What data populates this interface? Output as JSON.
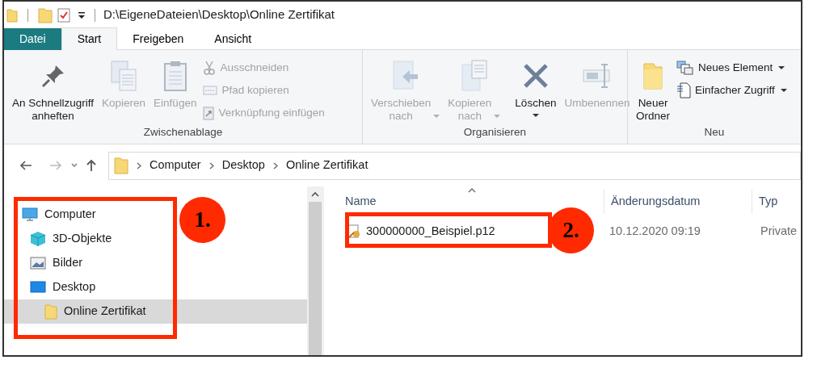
{
  "title_bar": {
    "path": "D:\\EigeneDateien\\Desktop\\Online Zertifikat"
  },
  "tabs": [
    {
      "label": "Datei",
      "kind": "file",
      "selected": false
    },
    {
      "label": "Start",
      "kind": "tab",
      "selected": true
    },
    {
      "label": "Freigeben",
      "kind": "tab",
      "selected": false
    },
    {
      "label": "Ansicht",
      "kind": "tab",
      "selected": false
    }
  ],
  "ribbon": {
    "groups": [
      {
        "label": "Zwischenablage",
        "items": [
          {
            "label": "An Schnellzugriff\nanheften",
            "kind": "large",
            "disabled": false,
            "dropdown": false
          },
          {
            "label": "Kopieren",
            "kind": "large",
            "disabled": true,
            "dropdown": false
          },
          {
            "label": "Einfügen",
            "kind": "large",
            "disabled": true,
            "dropdown": false
          },
          {
            "label": "Ausschneiden",
            "kind": "small",
            "disabled": true,
            "dropdown": false
          },
          {
            "label": "Pfad kopieren",
            "kind": "small",
            "disabled": true,
            "dropdown": false
          },
          {
            "label": "Verknüpfung einfügen",
            "kind": "small",
            "disabled": true,
            "dropdown": false
          }
        ]
      },
      {
        "label": "Organisieren",
        "items": [
          {
            "label": "Verschieben\nnach",
            "kind": "large",
            "disabled": true,
            "dropdown": true
          },
          {
            "label": "Kopieren\nnach",
            "kind": "large",
            "disabled": true,
            "dropdown": true
          },
          {
            "label": "Löschen",
            "kind": "large",
            "disabled": false,
            "dropdown": true
          },
          {
            "label": "Umbenennen",
            "kind": "large",
            "disabled": true,
            "dropdown": false
          }
        ]
      },
      {
        "label": "Neu",
        "items": [
          {
            "label": "Neuer\nOrdner",
            "kind": "large",
            "disabled": false,
            "dropdown": false
          },
          {
            "label": "Neues Element",
            "kind": "small",
            "disabled": false,
            "dropdown": true
          },
          {
            "label": "Einfacher Zugriff",
            "kind": "small",
            "disabled": false,
            "dropdown": true
          }
        ]
      }
    ]
  },
  "address_bar": {
    "crumbs": [
      "Computer",
      "Desktop",
      "Online Zertifikat"
    ]
  },
  "nav_pane": {
    "items": [
      {
        "label": "Computer",
        "selected": false,
        "children": [
          {
            "label": "3D-Objekte",
            "selected": false
          },
          {
            "label": "Bilder",
            "selected": false
          },
          {
            "label": "Desktop",
            "selected": false,
            "children": [
              {
                "label": "Online Zertifikat",
                "selected": true
              }
            ]
          }
        ]
      }
    ]
  },
  "file_list": {
    "columns": [
      "Name",
      "Änderungsdatum",
      "Typ"
    ],
    "rows": [
      {
        "cells": [
          "300000000_Beispiel.p12",
          "10.12.2020 09:19",
          "Private"
        ]
      }
    ]
  },
  "callouts": [
    {
      "label": "1."
    },
    {
      "label": "2."
    }
  ]
}
